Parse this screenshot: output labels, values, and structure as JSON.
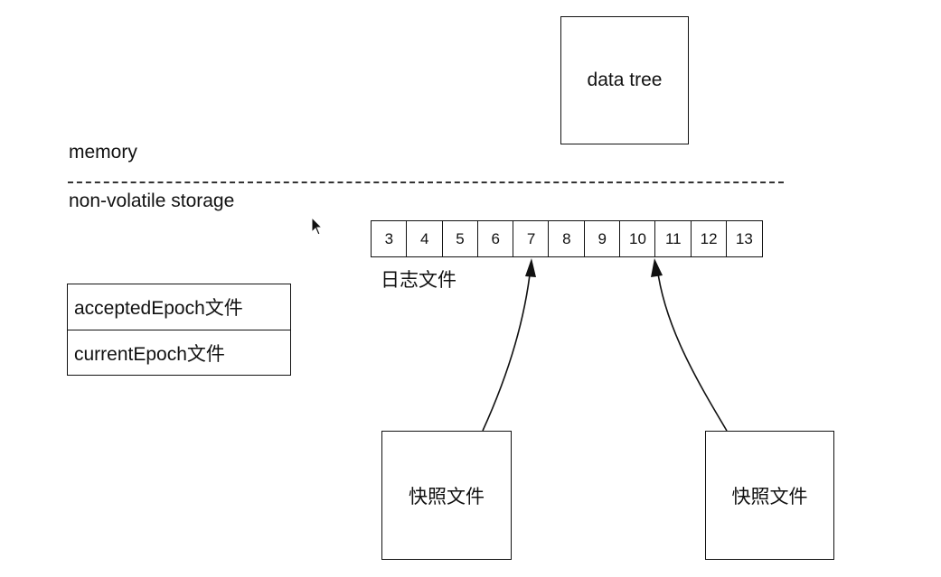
{
  "memory_label": "memory",
  "storage_label": "non-volatile storage",
  "data_tree_label": "data tree",
  "log": {
    "cells": [
      "3",
      "4",
      "5",
      "6",
      "7",
      "8",
      "9",
      "10",
      "11",
      "12",
      "13"
    ],
    "caption": "日志文件"
  },
  "epoch_files": {
    "accepted": "acceptedEpoch文件",
    "current": "currentEpoch文件"
  },
  "snapshots": [
    {
      "label": "快照文件",
      "points_to": "7"
    },
    {
      "label": "快照文件",
      "points_to": "10"
    }
  ],
  "icons": {
    "cursor": "mouse-pointer-icon"
  }
}
